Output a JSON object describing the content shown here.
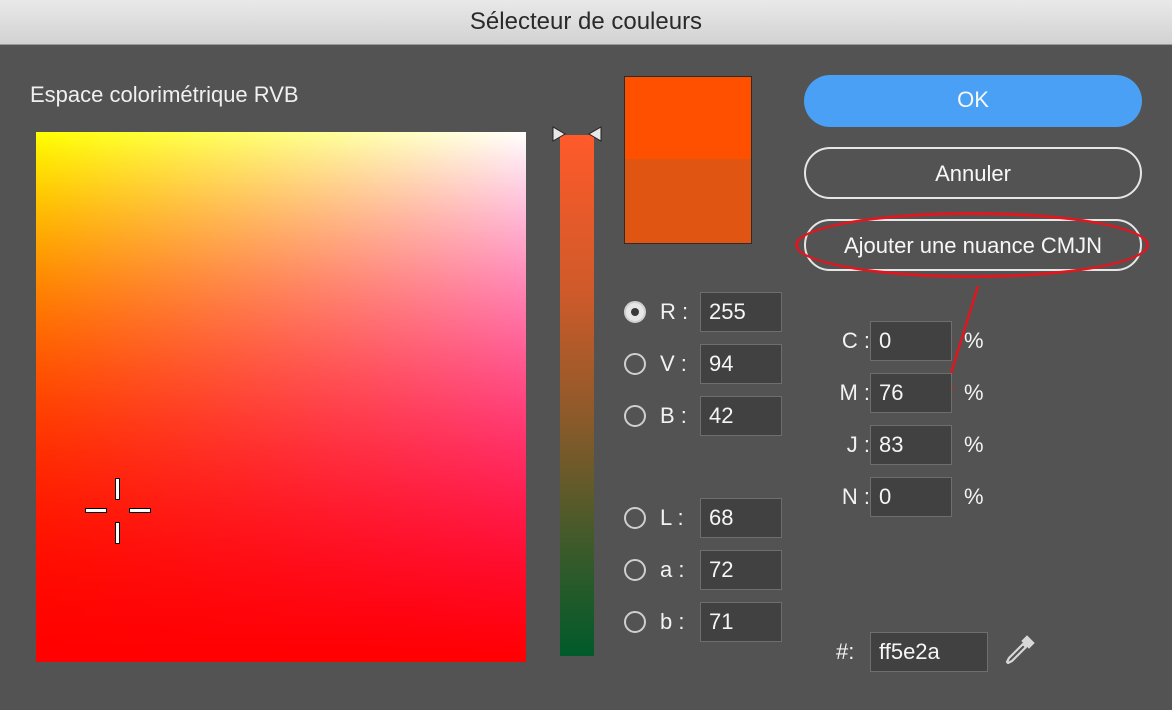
{
  "window": {
    "title": "Sélecteur de couleurs"
  },
  "picker": {
    "space_label": "Espace colorimétrique RVB"
  },
  "colors": {
    "new": "#ff5000",
    "old": "#e05512",
    "accent": "#4aa0f5",
    "annotation": "#e0171f"
  },
  "rgb": [
    {
      "label": "R :",
      "value": "255",
      "selected": true
    },
    {
      "label": "V :",
      "value": "94",
      "selected": false
    },
    {
      "label": "B :",
      "value": "42",
      "selected": false
    }
  ],
  "lab": [
    {
      "label": "L :",
      "value": "68",
      "selected": false
    },
    {
      "label": "a :",
      "value": "72",
      "selected": false
    },
    {
      "label": "b :",
      "value": "71",
      "selected": false
    }
  ],
  "buttons": {
    "ok": "OK",
    "cancel": "Annuler",
    "add_cmyk": "Ajouter une nuance CMJN"
  },
  "cmyk": [
    {
      "label": "C :",
      "value": "0",
      "unit": "%"
    },
    {
      "label": "M :",
      "value": "76",
      "unit": "%"
    },
    {
      "label": "J :",
      "value": "83",
      "unit": "%"
    },
    {
      "label": "N :",
      "value": "0",
      "unit": "%"
    }
  ],
  "hex": {
    "label": "#:",
    "value": "ff5e2a"
  },
  "icons": {
    "eyedropper": "eyedropper-icon"
  }
}
